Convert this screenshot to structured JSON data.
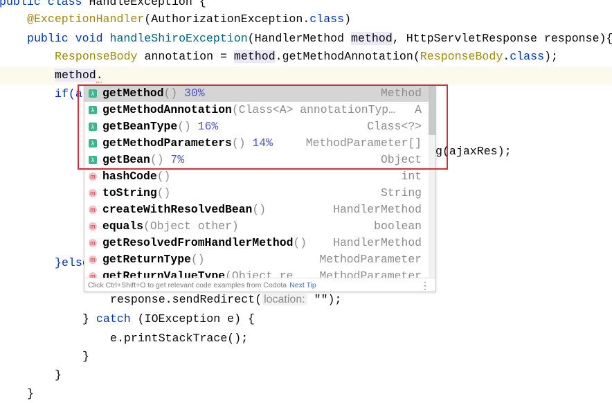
{
  "editor": {
    "lines": {
      "l0": {
        "kw": "public class ",
        "rest": "HandleException {"
      },
      "l1": {
        "ann": "@ExceptionHandler",
        "a": "(AuthorizationException.",
        "kw": "class",
        "b": ")"
      },
      "l2": {
        "kw": "public void ",
        "fn": "handleShiroException",
        "a": "(HandlerMethod ",
        "hl": "method",
        "b": ", HttpServletResponse response){"
      },
      "l3": {
        "ann1": "ResponseBody",
        "a": " annotation = ",
        "hl": "method",
        "b": ".getMethodAnnotation(",
        "ann2": "ResponseBody",
        "c": ".",
        "kw": "class",
        "d": ");"
      },
      "l4": {
        "hl": "method",
        "a": "."
      },
      "l5": {
        "text": "if(a"
      },
      "l8": {
        "text": "g(ajaxRes);"
      },
      "l14": {
        "text": "}else"
      },
      "l16": {
        "a": "response.sendRedirect(",
        "hint": "location:",
        "b": " \"\");"
      },
      "l17": {
        "a": "} ",
        "kw": "catch",
        "b": " (IOException e) {"
      },
      "l18": {
        "text": "e.printStackTrace();"
      },
      "l19": {
        "text": "}"
      },
      "l20": {
        "text": "}"
      },
      "l21": {
        "text": "}"
      }
    }
  },
  "completion": {
    "items": [
      {
        "icon": "lambda-method-icon",
        "name": "getMethod",
        "params": "()",
        "pct": "30%",
        "type": "Method"
      },
      {
        "icon": "lambda-method-icon",
        "name": "getMethodAnnotation",
        "params": "(Class<A> annotationTyp…",
        "pct": "",
        "type": "A"
      },
      {
        "icon": "lambda-method-icon",
        "name": "getBeanType",
        "params": "()",
        "pct": "16%",
        "type": "Class<?>"
      },
      {
        "icon": "lambda-method-icon",
        "name": "getMethodParameters",
        "params": "()",
        "pct": "14%",
        "type": "MethodParameter[]"
      },
      {
        "icon": "lambda-method-icon",
        "name": "getBean",
        "params": "()",
        "pct": "7%",
        "type": "Object"
      },
      {
        "icon": "method-icon",
        "name": "hashCode",
        "params": "()",
        "pct": "",
        "type": "int"
      },
      {
        "icon": "method-icon",
        "name": "toString",
        "params": "()",
        "pct": "",
        "type": "String"
      },
      {
        "icon": "method-icon",
        "name": "createWithResolvedBean",
        "params": "()",
        "pct": "",
        "type": "HandlerMethod"
      },
      {
        "icon": "method-icon",
        "name": "equals",
        "params": "(Object other)",
        "pct": "",
        "type": "boolean"
      },
      {
        "icon": "method-icon",
        "name": "getResolvedFromHandlerMethod",
        "params": "()",
        "pct": "",
        "type": "HandlerMethod"
      },
      {
        "icon": "method-icon",
        "name": "getReturnType",
        "params": "()",
        "pct": "",
        "type": "MethodParameter"
      },
      {
        "icon": "method-icon",
        "name": "getReturnValueType",
        "params": "(Object re…",
        "pct": "",
        "type": "MethodParameter"
      }
    ],
    "icon_glyphs": {
      "lambda": "λ",
      "method": "m"
    },
    "footer": {
      "text": "Click Ctrl+Shift+O to get relevant code examples from Codota",
      "next_tip": "Next Tip",
      "more": "⋮"
    }
  },
  "colors": {
    "highlight_box": "#d0303a",
    "keyword": "#0033b3",
    "annotation": "#9e880d"
  }
}
